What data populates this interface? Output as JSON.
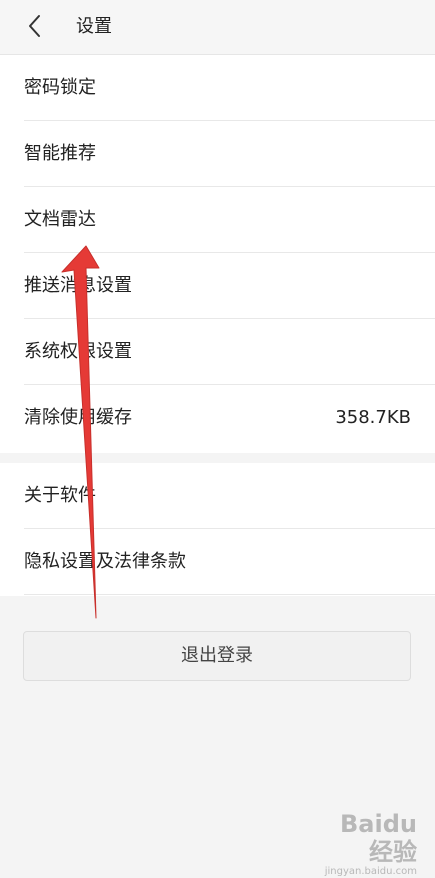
{
  "header": {
    "title": "设置",
    "back_icon": "chevron-left-icon"
  },
  "settings_group_1": [
    {
      "label": "密码锁定"
    },
    {
      "label": "智能推荐"
    },
    {
      "label": "文档雷达"
    },
    {
      "label": "推送消息设置"
    },
    {
      "label": "系统权限设置"
    },
    {
      "label": "清除使用缓存",
      "value": "358.7KB"
    }
  ],
  "settings_group_2": [
    {
      "label": "关于软件"
    },
    {
      "label": "隐私设置及法律条款"
    }
  ],
  "logout": {
    "label": "退出登录"
  },
  "annotation": {
    "color": "#e53a36",
    "icon": "red-arrow-pointing-up"
  },
  "watermark": {
    "text": "Baidu经验",
    "sub": "jingyan.baidu.com"
  }
}
